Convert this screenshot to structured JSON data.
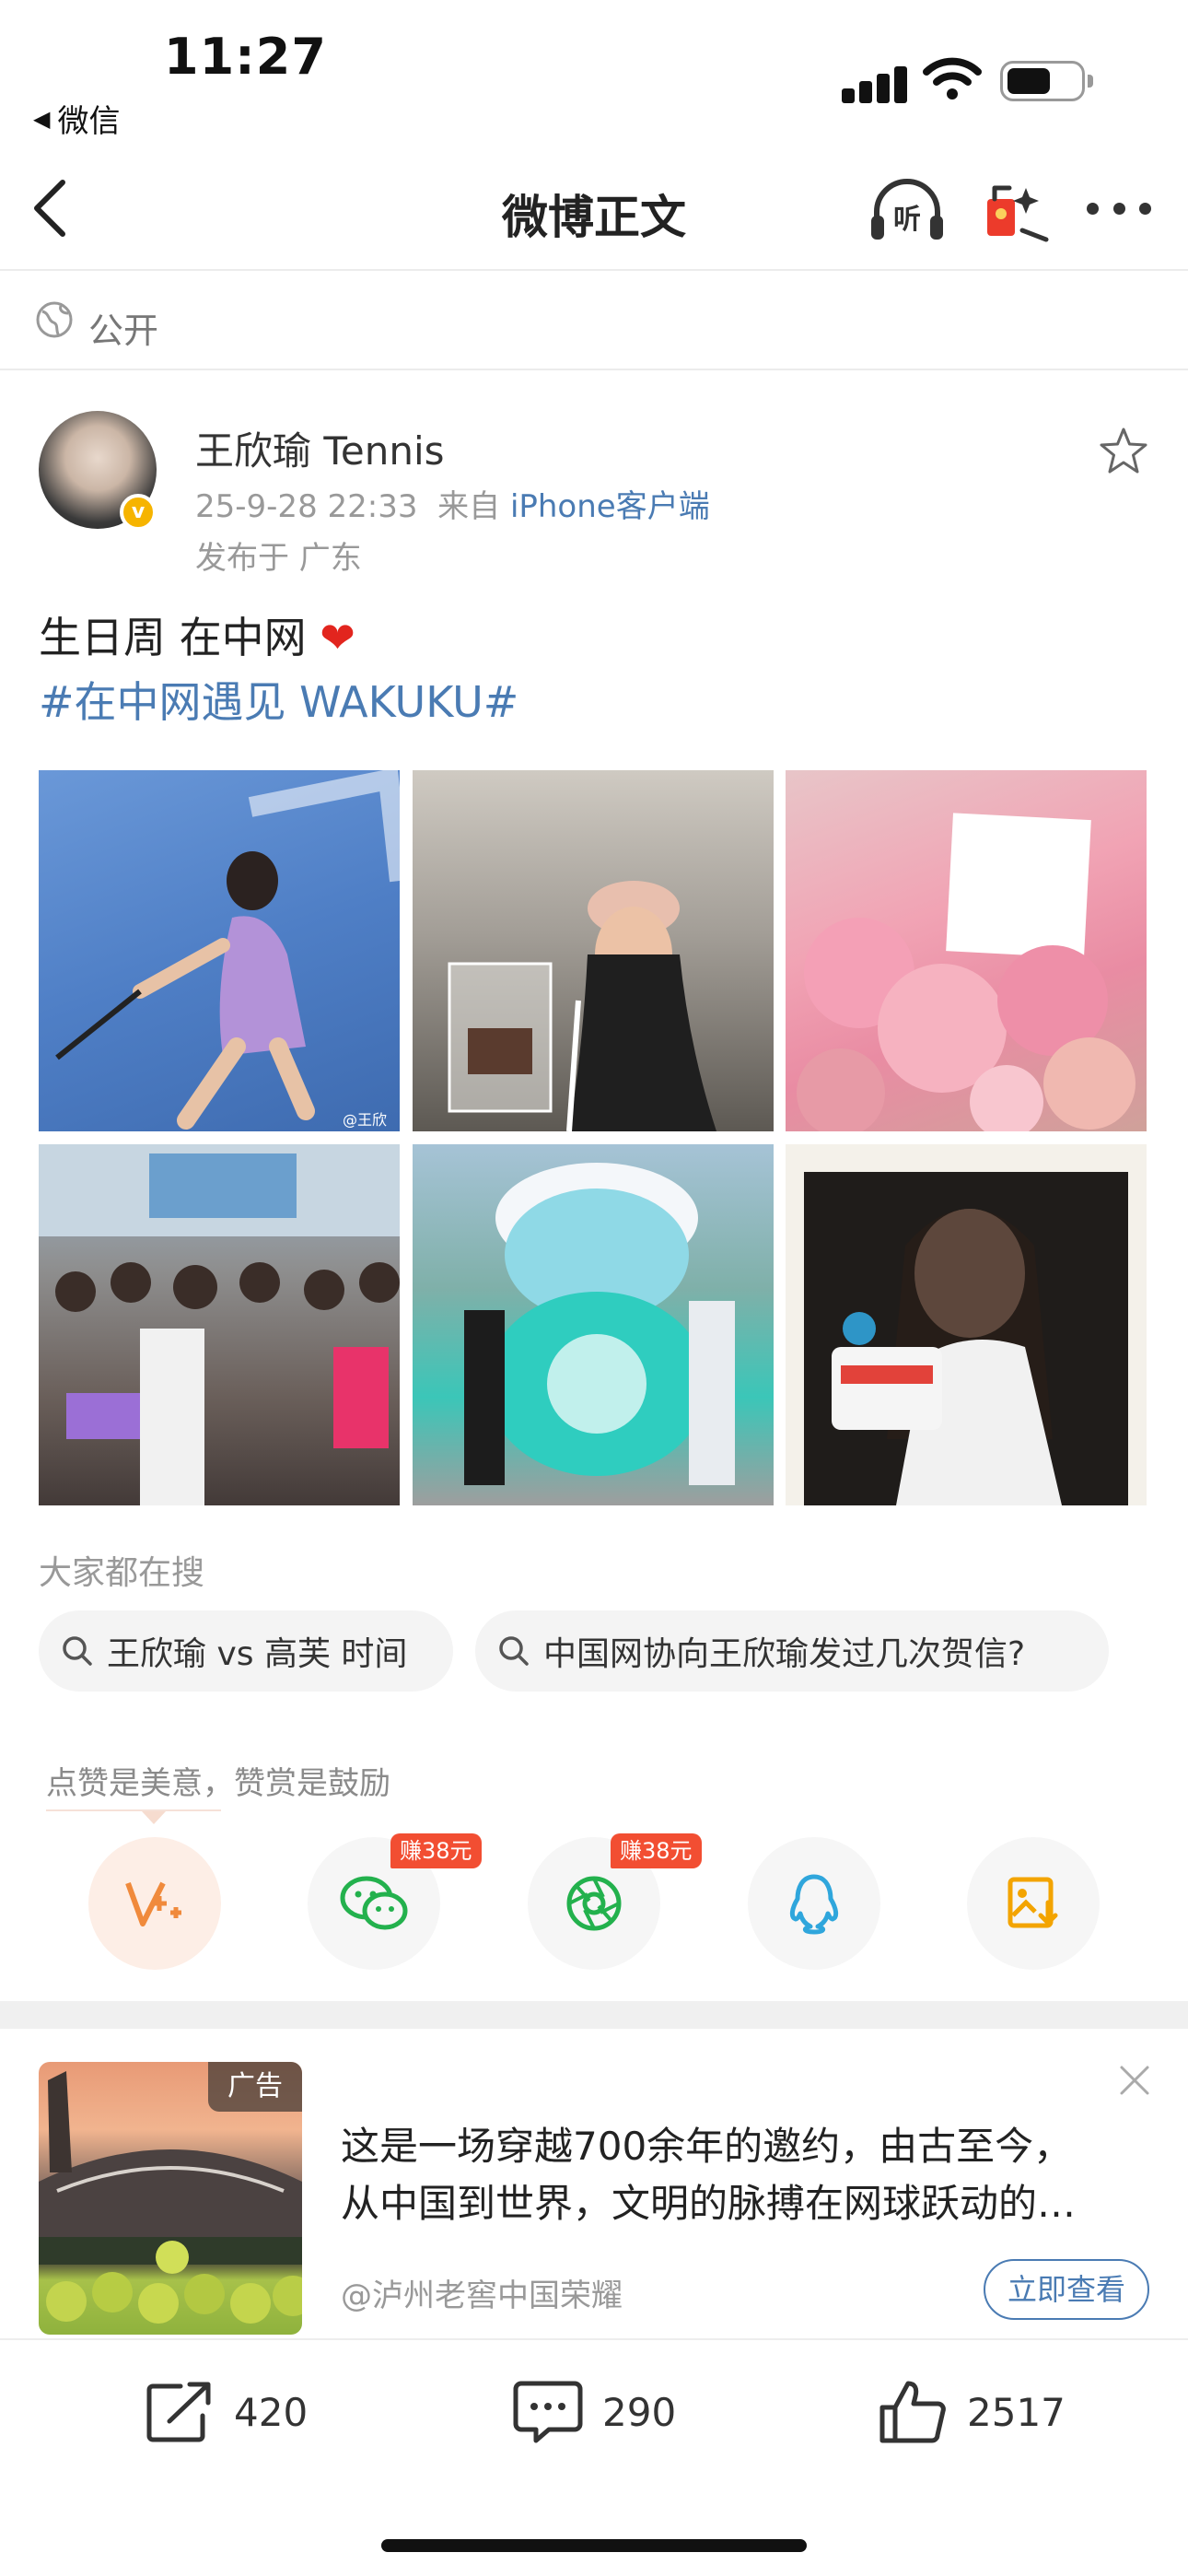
{
  "status_bar": {
    "time": "11:27",
    "back_app": "微信"
  },
  "nav": {
    "title": "微博正文",
    "listen_label": "听"
  },
  "visibility": "公开",
  "author": {
    "name": "王欣瑜 Tennis",
    "date": "25-9-28 22:33",
    "source_prefix": "来自",
    "client": "iPhone客户端",
    "location": "发布于 广东"
  },
  "post": {
    "text": "生日周 在中网",
    "heart": "❤",
    "hashtag": "#在中网遇见 WAKUKU#"
  },
  "photos": [
    {
      "watermark": "@王欣"
    },
    {
      "watermark": ""
    },
    {
      "watermark": ""
    },
    {
      "watermark": ""
    },
    {
      "watermark": ""
    },
    {
      "watermark": ""
    }
  ],
  "searches": {
    "heading": "大家都在搜",
    "items": [
      "王欣瑜 vs 高芙 时间",
      "中国网协向王欣瑜发过几次贺信?"
    ]
  },
  "share": {
    "encourage": "点赞是美意，赞赏是鼓励",
    "earn_badge_1": "赚38元",
    "earn_badge_2": "赚38元"
  },
  "ad": {
    "badge": "广告",
    "line1": "这是一场穿越700余年的邀约，由古至今，",
    "line2": "从中国到世界，文明的脉搏在网球跃动的…",
    "source": "@泸州老窖中国荣耀",
    "cta": "立即查看"
  },
  "actions": {
    "reposts": "420",
    "comments": "290",
    "likes": "2517"
  },
  "colors": {
    "link": "#4a7bb3",
    "badge_red": "#f24e32",
    "verified": "#f6b400"
  }
}
